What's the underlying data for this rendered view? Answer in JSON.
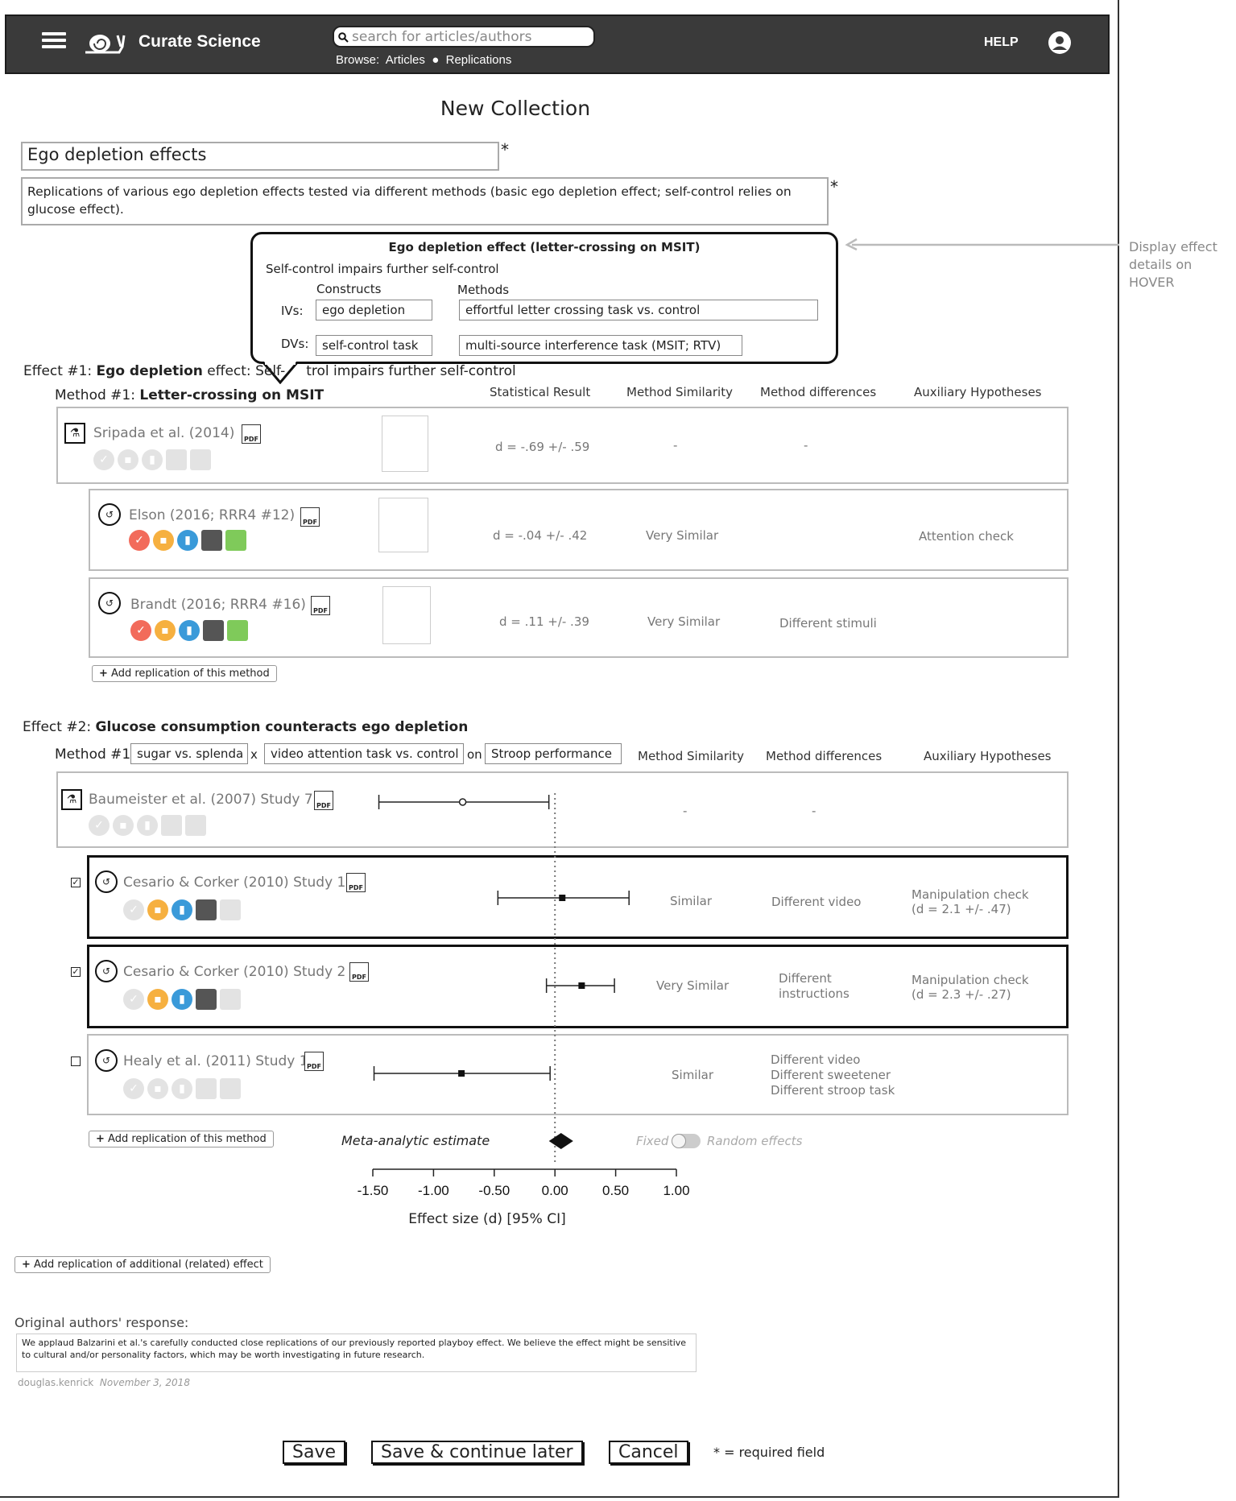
{
  "nav": {
    "brand": "Curate Science",
    "search_placeholder": "search for articles/authors",
    "browse_label": "Browse:",
    "browse_articles": "Articles",
    "browse_replications": "Replications",
    "help": "HELP"
  },
  "page": {
    "title": "New Collection",
    "collection_name": "Ego depletion effects",
    "collection_description": "Replications of various ego depletion effects tested via different methods (basic ego depletion effect; self-control relies on glucose effect).",
    "required_marker": "*",
    "hover_note": "Display effect details on HOVER"
  },
  "tooltip": {
    "title": "Ego depletion effect (letter-crossing on MSIT)",
    "subtitle": "Self-control impairs further self-control",
    "constructs_header": "Constructs",
    "methods_header": "Methods",
    "iv_label": "IVs:",
    "iv_construct": "ego depletion",
    "iv_method": "effortful letter crossing task vs. control",
    "dv_label": "DVs:",
    "dv_construct": "self-control task",
    "dv_method": "multi-source interference task (MSIT; RTV)"
  },
  "effect1": {
    "prefix": "Effect #1:",
    "name": "Ego depletion",
    "name_suffix": "effect:",
    "desc_a": "Self-",
    "desc_b": "trol impairs further self-control",
    "method_prefix": "Method #1:",
    "method_name": "Letter-crossing on MSIT",
    "headers": [
      "Statistical Result",
      "Method Similarity",
      "Method differences",
      "Auxiliary Hypotheses"
    ],
    "rows": [
      {
        "study": "Sripada et al. (2014)",
        "stat": "d = -.69 +/- .59",
        "similarity": "-",
        "differences": "-",
        "aux": ""
      },
      {
        "study": "Elson (2016; RRR4 #12)",
        "stat": "d =  -.04 +/- .42",
        "similarity": "Very Similar",
        "differences": "",
        "aux": "Attention check"
      },
      {
        "study": "Brandt (2016; RRR4 #16)",
        "stat": "d = .11 +/- .39",
        "similarity": "Very Similar",
        "differences": "Different stimuli",
        "aux": ""
      }
    ],
    "add_replication": "Add replication of this method"
  },
  "effect2": {
    "prefix": "Effect #2:",
    "name": "Glucose consumption counteracts ego depletion",
    "method_prefix": "Method #1:",
    "iv_a": "sugar vs. splenda",
    "times": "x",
    "iv_b": "video attention task vs. control",
    "on": "on",
    "dv": "Stroop performance",
    "headers": [
      "Method Similarity",
      "Method differences",
      "Auxiliary Hypotheses"
    ],
    "rows": [
      {
        "study": "Baumeister et al. (2007) Study 7",
        "similarity": "-",
        "differences": "-",
        "aux1": "",
        "aux2": "",
        "checked": null
      },
      {
        "study": "Cesario & Corker (2010) Study 1",
        "similarity": "Similar",
        "differences": "Different video",
        "aux1": "Manipulation check",
        "aux2": "(d = 2.1 +/- .47)",
        "checked": true
      },
      {
        "study": "Cesario & Corker (2010) Study 2",
        "similarity": "Very Similar",
        "differences": "Different\ninstructions",
        "aux1": "Manipulation check",
        "aux2": "(d = 2.3 +/- .27)",
        "checked": true
      },
      {
        "study": "Healy et al. (2011) Study 1",
        "similarity": "Similar",
        "differences": "Different video\nDifferent sweetener\nDifferent stroop task",
        "aux1": "",
        "aux2": "",
        "checked": false
      }
    ],
    "add_replication": "Add replication of this method",
    "meta_label": "Meta-analytic estimate",
    "toggle_fixed": "Fixed",
    "toggle_random": "Random effects"
  },
  "chart_data": {
    "type": "scatter",
    "xlabel": "Effect size (d) [95% CI]",
    "xlim": [
      -1.5,
      1.0
    ],
    "ticks": [
      "-1.50",
      "-1.00",
      "-0.50",
      "0.00",
      "0.50",
      "1.00"
    ],
    "tick_values": [
      -1.5,
      -1.0,
      -0.5,
      0.0,
      0.5,
      1.0
    ],
    "points": [
      {
        "study": "Baumeister et al. (2007) Study 7",
        "d": -0.76,
        "lo": -1.45,
        "hi": -0.05,
        "marker": "open"
      },
      {
        "study": "Cesario & Corker (2010) Study 1",
        "d": 0.06,
        "lo": -0.47,
        "hi": 0.61,
        "marker": "filled"
      },
      {
        "study": "Cesario & Corker (2010) Study 2",
        "d": 0.22,
        "lo": -0.07,
        "hi": 0.49,
        "marker": "filled"
      },
      {
        "study": "Healy et al. (2011) Study 1",
        "d": -0.77,
        "lo": -1.49,
        "hi": -0.04,
        "marker": "filled"
      }
    ],
    "meta_estimate": {
      "d": 0.05,
      "lo": -0.05,
      "hi": 0.15
    }
  },
  "footer": {
    "add_effect": "Add replication of additional (related) effect",
    "response_label": "Original authors' response:",
    "response_text": "We applaud Balzarini et al.'s carefully conducted close replications of our previously reported playboy effect. We believe the effect might be sensitive to cultural and/or personality factors, which may be worth investigating in future research.",
    "response_user": "douglas.kenrick",
    "response_date": "November 3, 2018",
    "save": "Save",
    "save_later": "Save & continue later",
    "cancel": "Cancel",
    "required_note": "* = required field"
  },
  "colors": {
    "topbar": "#3a3a3a",
    "red": "#f26b5b",
    "orange": "#f6b040",
    "blue": "#3a9ad9",
    "green": "#7fca5a",
    "faded": "#e3e3e3"
  }
}
